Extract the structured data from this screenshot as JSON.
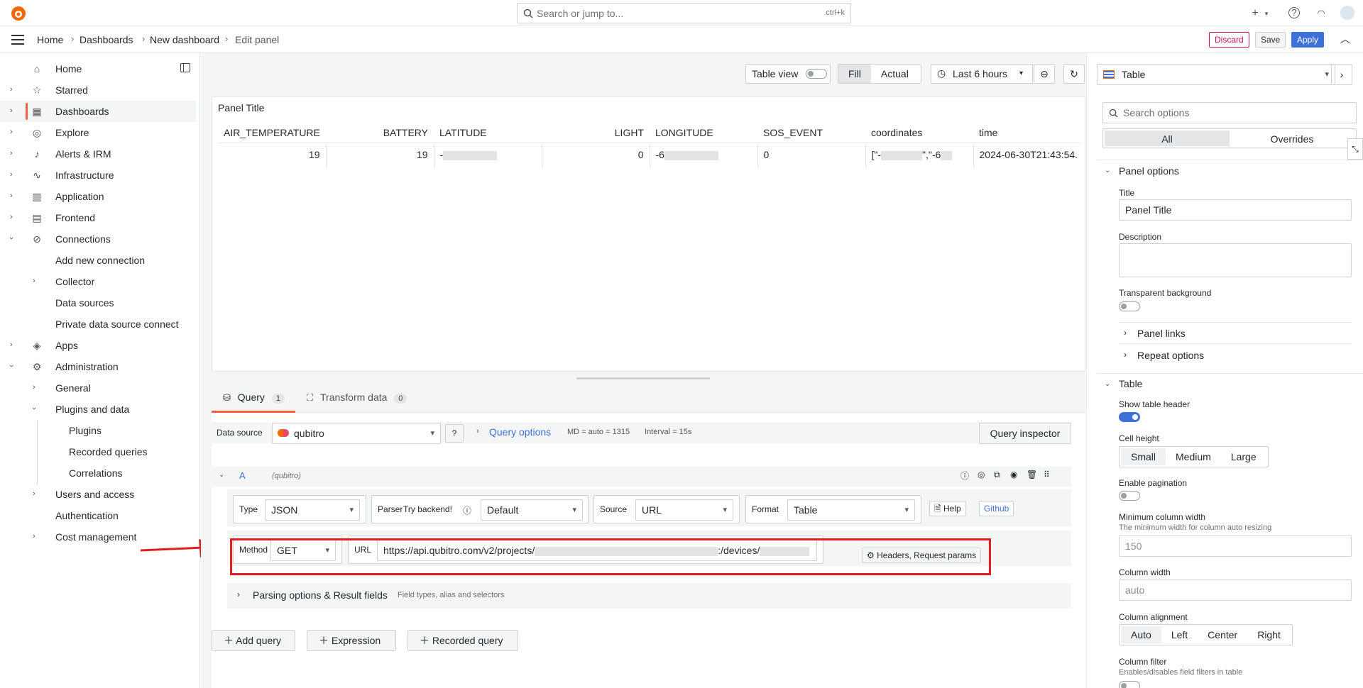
{
  "topbar": {
    "search_placeholder": "Search or jump to...",
    "search_shortcut": "ctrl+k"
  },
  "breadcrumb": [
    "Home",
    "Dashboards",
    "New dashboard",
    "Edit panel"
  ],
  "header_actions": {
    "discard": "Discard",
    "save": "Save",
    "apply": "Apply"
  },
  "sidebar": {
    "items": [
      {
        "label": "Home",
        "icon": "home-icon"
      },
      {
        "label": "Starred",
        "icon": "star-icon"
      },
      {
        "label": "Dashboards",
        "icon": "grid-icon"
      },
      {
        "label": "Explore",
        "icon": "compass-icon"
      },
      {
        "label": "Alerts & IRM",
        "icon": "bell-icon"
      },
      {
        "label": "Infrastructure",
        "icon": "pulse-icon"
      },
      {
        "label": "Application",
        "icon": "bar-chart-icon"
      },
      {
        "label": "Frontend",
        "icon": "browser-icon"
      },
      {
        "label": "Connections",
        "icon": "link-icon"
      },
      {
        "label": "Add new connection"
      },
      {
        "label": "Collector"
      },
      {
        "label": "Data sources"
      },
      {
        "label": "Private data source connect"
      },
      {
        "label": "Apps",
        "icon": "layers-icon"
      },
      {
        "label": "Administration",
        "icon": "gear-icon"
      },
      {
        "label": "General"
      },
      {
        "label": "Plugins and data"
      },
      {
        "label": "Plugins"
      },
      {
        "label": "Recorded queries"
      },
      {
        "label": "Correlations"
      },
      {
        "label": "Users and access"
      },
      {
        "label": "Authentication"
      },
      {
        "label": "Cost management"
      }
    ]
  },
  "toolbar": {
    "table_view": "Table view",
    "fill": "Fill",
    "actual": "Actual",
    "time_range": "Last 6 hours",
    "visualization": "Table"
  },
  "panel": {
    "title": "Panel Title",
    "columns": [
      "AIR_TEMPERATURE",
      "BATTERY",
      "LATITUDE",
      "LIGHT",
      "LONGITUDE",
      "SOS_EVENT",
      "coordinates",
      "time"
    ],
    "row": {
      "air_temperature": "19",
      "battery": "19",
      "latitude": "-",
      "light": "0",
      "longitude": "-6",
      "sos_event": "0",
      "coordinates": "[\"-",
      "coordinates_mid": "\",\"-6",
      "time": "2024-06-30T21:43:54."
    }
  },
  "tabs": {
    "query": "Query",
    "query_count": "1",
    "transform": "Transform data",
    "transform_count": "0"
  },
  "query": {
    "data_source_label": "Data source",
    "data_source": "qubitro",
    "query_options": "Query options",
    "md_info": "MD = auto = 1315",
    "interval_info": "Interval = 15s",
    "inspector": "Query inspector",
    "ref_id": "A",
    "ref_source": "(qubitro)",
    "type_label": "Type",
    "type_value": "JSON",
    "parser_label": "Parser",
    "parser_hint": "Try backend!",
    "parser_value": "Default",
    "source_label": "Source",
    "source_value": "URL",
    "format_label": "Format",
    "format_value": "Table",
    "help": "Help",
    "github": "Github",
    "method_label": "Method",
    "method_value": "GET",
    "url_label": "URL",
    "url_prefix": "https://api.qubitro.com/v2/projects/",
    "url_mid": ":/devices/",
    "headers_button": "Headers, Request params",
    "parsing_title": "Parsing options & Result fields",
    "parsing_hint": "Field types, alias and selectors",
    "add_query": "Add query",
    "expression": "Expression",
    "recorded_query": "Recorded query"
  },
  "options": {
    "search_placeholder": "Search options",
    "all": "All",
    "overrides": "Overrides",
    "panel_options": "Panel options",
    "title_label": "Title",
    "title_value": "Panel Title",
    "description_label": "Description",
    "transparent_label": "Transparent background",
    "panel_links": "Panel links",
    "repeat_options": "Repeat options",
    "table_section": "Table",
    "show_header_label": "Show table header",
    "cell_height_label": "Cell height",
    "cell_heights": [
      "Small",
      "Medium",
      "Large"
    ],
    "pagination_label": "Enable pagination",
    "min_col_width_label": "Minimum column width",
    "min_col_width_desc": "The minimum width for column auto resizing",
    "min_col_width_ph": "150",
    "col_width_label": "Column width",
    "col_width_ph": "auto",
    "col_align_label": "Column alignment",
    "col_aligns": [
      "Auto",
      "Left",
      "Center",
      "Right"
    ],
    "col_filter_label": "Column filter",
    "col_filter_desc": "Enables/disables field filters in table"
  },
  "colors": {
    "accent": "#f55f3e",
    "primary": "#3d71d9",
    "highlight": "#e02020"
  }
}
